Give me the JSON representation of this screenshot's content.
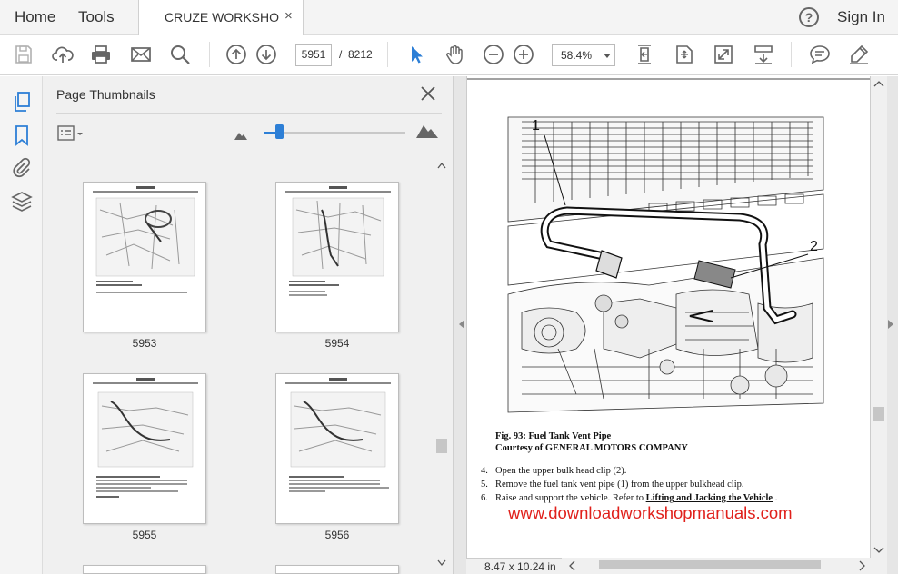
{
  "menubar": {
    "home": "Home",
    "tools": "Tools",
    "tab_title": "CRUZE WORKSHO...",
    "tab_close": "×",
    "help": "?",
    "sign_in": "Sign In"
  },
  "toolbar": {
    "current_page": "5951",
    "page_separator": "/",
    "total_pages": "8212",
    "zoom": "58.4%"
  },
  "thumbnails": {
    "panel_title": "Page Thumbnails",
    "pages": [
      {
        "label": "5953"
      },
      {
        "label": "5954"
      },
      {
        "label": "5955"
      },
      {
        "label": "5956"
      }
    ]
  },
  "document": {
    "callout_1": "1",
    "callout_2": "2",
    "fig_caption": "Fig. 93: Fuel Tank Vent Pipe",
    "fig_credit": "Courtesy of GENERAL MOTORS COMPANY",
    "steps": [
      {
        "num": "4.",
        "text": "Open the upper bulk head clip (2)."
      },
      {
        "num": "5.",
        "text": "Remove the fuel tank vent pipe (1) from the upper bulkhead clip."
      },
      {
        "num": "6.",
        "text": "Raise and support the vehicle. Refer to ",
        "link": "Lifting and Jacking the Vehicle",
        "after": " ."
      }
    ],
    "watermark": "www.downloadworkshopmanuals.com",
    "page_size": "8.47 x 10.24 in"
  },
  "colors": {
    "accent": "#2d7fd6",
    "watermark": "#e0201b",
    "icon": "#666666"
  }
}
